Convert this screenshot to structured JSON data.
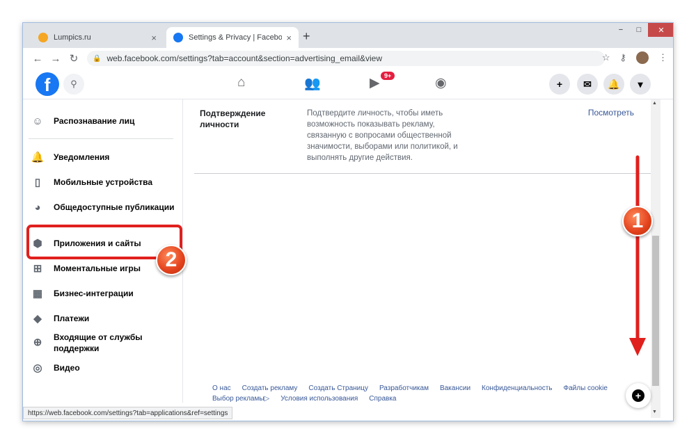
{
  "browser": {
    "tabs": [
      {
        "title": "Lumpics.ru",
        "close": "×",
        "active": false
      },
      {
        "title": "Settings & Privacy | Facebook",
        "close": "×",
        "active": true
      }
    ],
    "new_tab": "+",
    "url": "web.facebook.com/settings?tab=account&section=advertising_email&view",
    "status_url": "https://web.facebook.com/settings?tab=applications&ref=settings",
    "window_controls": {
      "minimize": "−",
      "maximize": "□",
      "close": "✕"
    }
  },
  "facebook_nav": {
    "logo": "f",
    "notification_badge": "9+",
    "icons": [
      "search-icon",
      "home-icon",
      "friends-icon",
      "watch-icon",
      "groups-icon",
      "plus-icon",
      "messenger-icon",
      "notifications-icon",
      "menu-arrow-icon"
    ]
  },
  "sidebar": {
    "items": [
      {
        "label": "Распознавание лиц",
        "icon": "face-recognition-icon"
      },
      {
        "label": "Уведомления",
        "icon": "bell-icon"
      },
      {
        "label": "Мобильные устройства",
        "icon": "mobile-icon"
      },
      {
        "label": "Общедоступные публикации",
        "icon": "globe-icon"
      },
      {
        "label": "Приложения и сайты",
        "icon": "cube-icon"
      },
      {
        "label": "Моментальные игры",
        "icon": "gamepad-icon"
      },
      {
        "label": "Бизнес-интеграции",
        "icon": "business-icon"
      },
      {
        "label": "Платежи",
        "icon": "payments-icon"
      },
      {
        "label": "Входящие от службы",
        "label2": "поддержки",
        "icon": "support-icon"
      },
      {
        "label": "Видео",
        "icon": "video-icon"
      }
    ]
  },
  "main": {
    "setting": {
      "label_line1": "Подтверждение",
      "label_line2": "личности",
      "description": "Подтвердите личность, чтобы иметь возможность показывать рекламу, связанную с вопросами общественной значимости, выборами или политикой, и выполнять другие действия.",
      "link": "Посмотреть"
    }
  },
  "footer": {
    "links_row1": [
      "О нас",
      "Создать рекламу",
      "Создать Страницу",
      "Разработчикам",
      "Вакансии",
      "Конфиденциальность",
      "Файлы cookie"
    ],
    "links_row2": [
      "Выбор рекламы▷",
      "Условия использования",
      "Справка"
    ]
  },
  "annotations": {
    "marker1": "1",
    "marker2": "2",
    "accent_color": "#e0201d"
  }
}
